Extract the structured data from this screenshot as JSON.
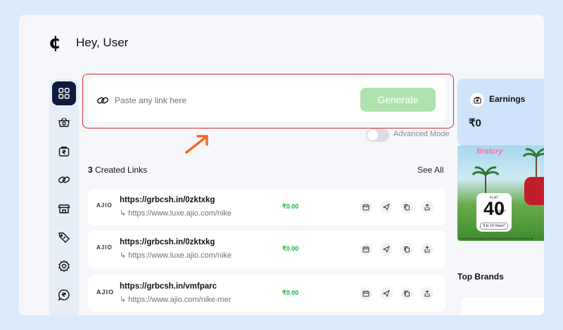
{
  "header": {
    "logo_glyph": "¢",
    "greeting": "Hey, User"
  },
  "sidebar": {
    "items": [
      {
        "icon": "grid-icon",
        "active": true
      },
      {
        "icon": "basket-icon"
      },
      {
        "icon": "bag-rupee-icon"
      },
      {
        "icon": "link-icon"
      },
      {
        "icon": "store-icon"
      },
      {
        "icon": "tag-icon"
      },
      {
        "icon": "gear-icon"
      },
      {
        "icon": "rupee-chat-icon"
      }
    ]
  },
  "link_generator": {
    "placeholder": "Paste any link here",
    "generate_label": "Generate",
    "advanced_mode_label": "Advanced Mode"
  },
  "links": {
    "count": "3",
    "heading_suffix": "Created Links",
    "see_all": "See All",
    "rows": [
      {
        "brand": "AJIO",
        "short_url": "https://grbcsh.in/0zktxkg",
        "long_url": "↳ https://www.luxe.ajio.com/nike",
        "earnings": "₹0.00"
      },
      {
        "brand": "AJIO",
        "short_url": "https://grbcsh.in/0zktxkg",
        "long_url": "↳ https://www.luxe.ajio.com/nike",
        "earnings": "₹0.00"
      },
      {
        "brand": "AJIO",
        "short_url": "https://grbcsh.in/vmfparc",
        "long_url": "↳ https://www.ajio.com/nike-mer",
        "earnings": "₹0.00"
      }
    ]
  },
  "earnings": {
    "title": "Earnings",
    "amount": "₹0"
  },
  "banner": {
    "logo": "firstcry",
    "flat": "FLAT",
    "percent": "40",
    "off": "OFF*",
    "years": "0 to 14 Years*",
    "fine_print": "*t new all merch summer 2024 new all merch summer 2024 new all"
  },
  "top_brands": {
    "title": "Top Brands"
  },
  "colors": {
    "accent_dark": "#0f1b3d",
    "generate_green": "#aee3ae",
    "earn_green": "#22b04b",
    "highlight_red": "#d62b2b",
    "arrow_orange": "#f26b21"
  }
}
